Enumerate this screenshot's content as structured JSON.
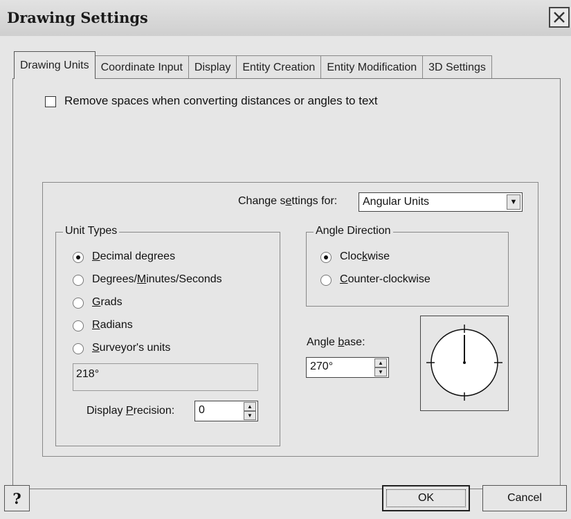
{
  "window": {
    "title": "Drawing Settings",
    "close_icon": "close-icon"
  },
  "tabs": [
    {
      "label": "Drawing Units",
      "active": true
    },
    {
      "label": "Coordinate Input",
      "active": false
    },
    {
      "label": "Display",
      "active": false
    },
    {
      "label": "Entity Creation",
      "active": false
    },
    {
      "label": "Entity Modification",
      "active": false
    },
    {
      "label": "3D Settings",
      "active": false
    }
  ],
  "remove_spaces": {
    "label": "Remove spaces when converting distances or angles to text",
    "checked": false
  },
  "change_settings": {
    "label_pre": "Change s",
    "label_mnemonic": "e",
    "label_post": "ttings for:",
    "value": "Angular Units"
  },
  "unit_types": {
    "title": "Unit Types",
    "options": [
      {
        "mn": "D",
        "rest": "ecimal degrees",
        "checked": true
      },
      {
        "mn": "",
        "rest": "Degrees/",
        "mn2": "M",
        "rest2": "inutes/Seconds",
        "checked": false
      },
      {
        "mn": "G",
        "rest": "rads",
        "checked": false
      },
      {
        "mn": "R",
        "rest": "adians",
        "checked": false
      },
      {
        "mn": "S",
        "rest": "urveyor's units",
        "checked": false
      }
    ],
    "sample": "218°",
    "precision_label_pre": "Display ",
    "precision_label_mnemonic": "P",
    "precision_label_post": "recision:",
    "precision_value": "0"
  },
  "angle_direction": {
    "title": "Angle Direction",
    "clockwise_pre": "Cloc",
    "clockwise_mn": "k",
    "clockwise_post": "wise",
    "counter_mn": "C",
    "counter_rest": "ounter-clockwise",
    "selected": "clockwise"
  },
  "angle_base": {
    "label_pre": "Angle ",
    "label_mnemonic": "b",
    "label_post": "ase:",
    "value": "270°"
  },
  "buttons": {
    "help": "?",
    "ok": "OK",
    "cancel": "Cancel"
  }
}
